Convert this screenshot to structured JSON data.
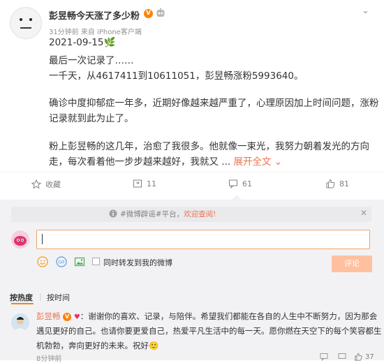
{
  "post": {
    "username": "彭昱畅今天涨了多少粉",
    "verified_badge": "V",
    "meta": "31分钟前 来自 iPhone客户端",
    "lines": [
      "2021-09-15🌿",
      "最后一次记录了……",
      "一千天，从4617411到10611051，彭昱畅涨粉5993640。",
      "确诊中度抑郁症一年多，近期好像越来越严重了，心理原因加上时间问题，涨粉",
      "记录就到此为止了。",
      "粉上彭昱畅的这几年，治愈了我很多。他就像一束光，我努力朝着发光的方向",
      "走，每次看着他一步步越来越好，我就又 ..."
    ],
    "expand_label": "展开全文",
    "expand_icon": "chevron-down-icon"
  },
  "actions": {
    "favorite": "收藏",
    "repost_count": "11",
    "comment_count": "61",
    "like_count": "81"
  },
  "comment_box": {
    "rumor_text": "#微博辟谣#平台，",
    "rumor_link": "欢迎查阅!",
    "input_value": "",
    "forward_label": "同时转发到我的微博",
    "submit_label": "评论",
    "submit_color": "#ffc09f"
  },
  "sort": {
    "hot": "按热度",
    "time": "按时间"
  },
  "comment": {
    "user": "彭昱畅",
    "badge": "V",
    "line1": "：谢谢你的喜欢、记录，与陪伴。希望我们都能在各自的人生中不断努力，因为那会",
    "line2": "遇见更好的自己。也请你要更爱自己，热爱平凡生活中的每一天。愿你燃在天空下的每个笑容都生",
    "line3": "机勃勃，奔向更好的未来。祝好🙂",
    "time": "8分钟前",
    "likes": "37"
  },
  "colors": {
    "accent": "#ff8200",
    "link": "#eb7350",
    "muted": "#939393"
  }
}
